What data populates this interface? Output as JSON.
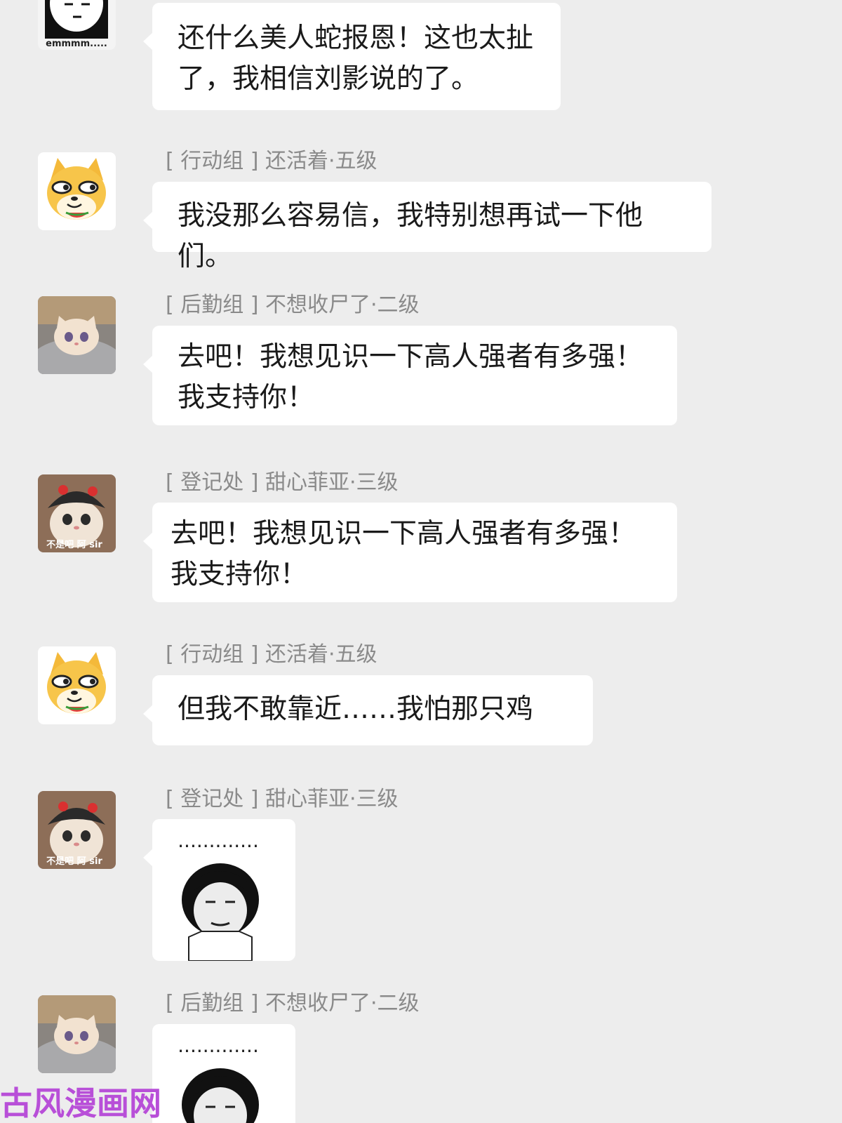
{
  "messages": [
    {
      "avatar": "panda-emmm-icon",
      "avatar_text": "emmmm.....",
      "sender": "",
      "text": "还什么美人蛇报恩！这也太扯\n了，我相信刘影说的了。"
    },
    {
      "avatar": "shiba-doge-icon",
      "sender": "[ 行动组 ] 还活着·五级",
      "text": "我没那么容易信，我特别想再试一下他们。"
    },
    {
      "avatar": "kitten-peeking-icon",
      "sender": "[ 后勤组 ] 不想收尸了·二级",
      "text": "去吧！我想见识一下高人强者有多强！\n我支持你！"
    },
    {
      "avatar": "cat-with-hat-icon",
      "avatar_text": "不是吧 阿 sir",
      "sender": "[ 登记处 ] 甜心菲亚·三级",
      "text": "去吧！我想见识一下高人强者有多强！\n我支持你！"
    },
    {
      "avatar": "shiba-doge-icon",
      "sender": "[ 行动组 ] 还活着·五级",
      "text": "但我不敢靠近……我怕那只鸡"
    },
    {
      "avatar": "cat-with-hat-icon",
      "avatar_text": "不是吧 阿 sir",
      "sender": "[ 登记处 ] 甜心菲亚·三级",
      "sticker": "speechless-meme-sticker",
      "sticker_text": "............."
    },
    {
      "avatar": "kitten-peeking-icon",
      "sender": "[ 后勤组 ] 不想收尸了·二级",
      "sticker": "speechless-meme-sticker",
      "sticker_text": "............."
    }
  ],
  "watermark": "古风漫画网",
  "colors": {
    "background": "#ededed",
    "bubble": "#ffffff",
    "sender_text": "#8a8a8a",
    "message_text": "#1a1a1a",
    "watermark": "#b84fd8"
  }
}
